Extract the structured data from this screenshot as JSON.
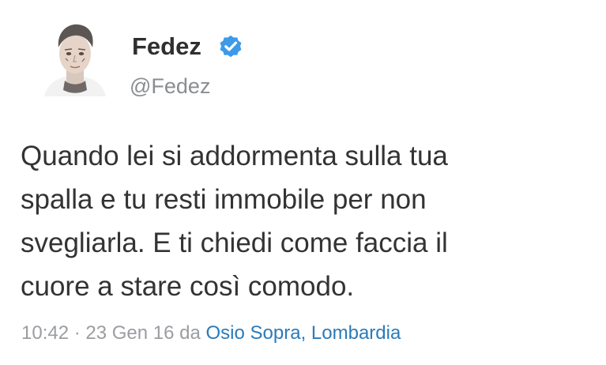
{
  "author": {
    "display_name": "Fedez",
    "handle": "@Fedez",
    "verified": true,
    "avatar_icon": "user-avatar"
  },
  "tweet": {
    "lines": [
      "Quando lei si addormenta sulla tua",
      "spalla e tu resti immobile per non",
      "svegliarla. E ti chiedi come faccia il",
      "cuore a stare così comodo."
    ]
  },
  "meta": {
    "timestamp": "10:42 · 23 Gen 16",
    "from_prefix": " da ",
    "location": "Osio Sopra, Lombardia"
  },
  "colors": {
    "verified_badge": "#3d9ae8",
    "location_link": "#2b7bb9",
    "text": "#333333",
    "muted": "#9a9da1"
  }
}
